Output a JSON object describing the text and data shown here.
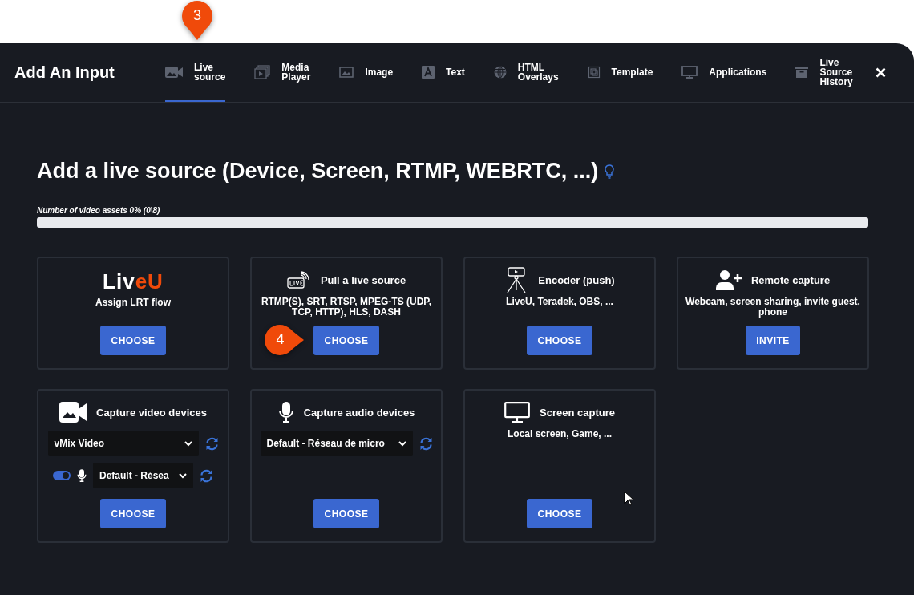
{
  "window": {
    "title": "Add An Input"
  },
  "tabs": [
    {
      "label": "Live source",
      "kind": "camera",
      "selected": true,
      "callout": "3"
    },
    {
      "label": "Media Player",
      "kind": "media",
      "selected": false
    },
    {
      "label": "Image",
      "kind": "image",
      "selected": false
    },
    {
      "label": "Text",
      "kind": "text",
      "selected": false
    },
    {
      "label": "HTML Overlays",
      "kind": "globe",
      "selected": false
    },
    {
      "label": "Template",
      "kind": "template",
      "selected": false
    },
    {
      "label": "Applications",
      "kind": "monitor",
      "selected": false
    },
    {
      "label": "Live Source History",
      "kind": "archive",
      "selected": false
    }
  ],
  "heading": "Add a live source (Device, Screen, RTMP, WEBRTC, ...)",
  "assets": {
    "label": "Number of video assets 0% (0\\8)",
    "level": 0
  },
  "cards": [
    {
      "kind": "logo",
      "logo": [
        "Liv",
        "eU"
      ],
      "title": "Assign LRT flow",
      "button": "CHOOSE"
    },
    {
      "kind": "live",
      "title": "Pull a live source",
      "description": "RTMP(S), SRT, RTSP, MPEG-TS (UDP, TCP, HTTP), HLS, DASH",
      "button": "CHOOSE",
      "callout": "4"
    },
    {
      "kind": "tripod",
      "title": "Encoder (push)",
      "description": "LiveU, Teradek, OBS, ...",
      "button": "CHOOSE"
    },
    {
      "kind": "adduser",
      "title": "Remote capture",
      "description": "Webcam, screen sharing, invite guest, phone",
      "button": "INVITE"
    },
    {
      "kind": "videocam",
      "title": "Capture video devices",
      "selects": [
        {
          "value": "vMix Video"
        },
        {
          "value": "Default - Résea",
          "on": true
        }
      ],
      "button": "CHOOSE"
    },
    {
      "kind": "mic",
      "title": "Capture audio devices",
      "selects": [
        {
          "value": "Default - Réseau de micro"
        }
      ],
      "button": "CHOOSE"
    },
    {
      "kind": "monitor",
      "title": "Screen capture",
      "description": "Local screen, Game, ...",
      "button": "CHOOSE"
    }
  ]
}
